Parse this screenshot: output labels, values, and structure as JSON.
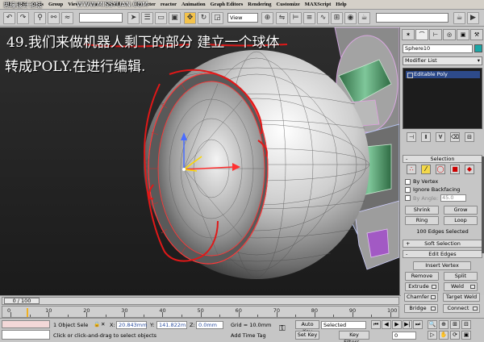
{
  "watermark": {
    "left": "思缘设计论坛",
    "center": "WWW.MISSYUAN.COM"
  },
  "menubar": {
    "items": [
      "File",
      "Edit",
      "Tools",
      "Group",
      "Views",
      "Create",
      "Modifiers",
      "Character",
      "reactor",
      "Animation",
      "Graph Editors",
      "Rendering",
      "Customize",
      "MAXScript",
      "Help"
    ]
  },
  "toolbar": {
    "view_select": "View"
  },
  "annotation": {
    "line1": "49.我们来做机器人剩下的部分  建立一个球体",
    "line2": "转成POLY.在进行编辑."
  },
  "command_panel": {
    "object_name": "Sphere10",
    "modifier_list": "Modifier List",
    "stack_item": "Editable Poly",
    "selection": {
      "title": "Selection",
      "by_vertex": "By Vertex",
      "ignore_backfacing": "Ignore Backfacing",
      "by_angle": "By Angle:",
      "angle_value": "45.0",
      "shrink": "Shrink",
      "grow": "Grow",
      "ring": "Ring",
      "loop": "Loop",
      "status": "100 Edges Selected"
    },
    "soft_selection": {
      "title": "Soft Selection"
    },
    "edit_edges": {
      "title": "Edit Edges",
      "insert_vertex": "Insert Vertex",
      "remove": "Remove",
      "split": "Split",
      "extrude": "Extrude",
      "weld": "Weld",
      "chamfer": "Chamfer",
      "target_weld": "Target Weld",
      "bridge": "Bridge",
      "connect": "Connect"
    }
  },
  "timeline": {
    "frame": "0 / 100",
    "ticks": [
      "0",
      "10",
      "20",
      "30",
      "40",
      "50",
      "60",
      "70",
      "80",
      "90",
      "100"
    ]
  },
  "statusbar": {
    "objects_selected": "1 Object Sele",
    "prompt": "Click or click-and-drag to select objects",
    "x_label": "X:",
    "x_value": "20.843mm",
    "y_label": "Y:",
    "y_value": "141.822m",
    "z_label": "Z:",
    "z_value": "0.0mm",
    "grid": "Grid = 10.0mm",
    "add_time_tag": "Add Time Tag",
    "auto_key": "Auto Key",
    "set_key": "Set Key",
    "selected": "Selected",
    "key_filters": "Key Filters...",
    "frame_field": "0"
  }
}
